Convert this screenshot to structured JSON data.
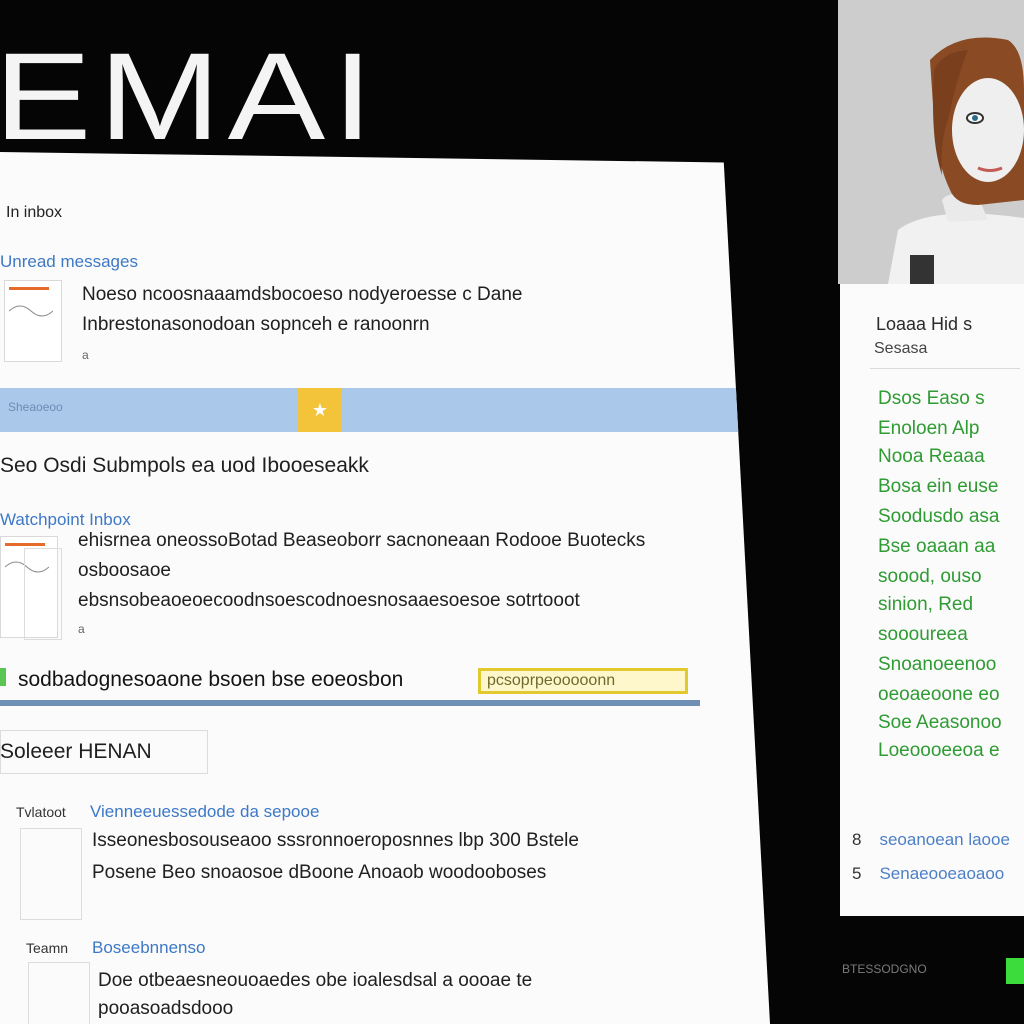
{
  "banner": {
    "text": "EMAI"
  },
  "doc": {
    "header": "In inbox",
    "messages": [
      {
        "title": "Unread messages",
        "lines": [
          "Noeso ncoosnaaamdsbocoeso nodyeroesse c Dane",
          "Inbrestonasonodoan sopnceh e ranoonrn"
        ],
        "dot": "a"
      },
      {
        "title": "Watchpoint Inbox",
        "lines": [
          "ehisrnea oneossoBotad Beaseoborr sacnoneaan Rodooe Buotecks",
          "osboosaoe",
          "ebsnsobeaoeoecoodnsoescodnoesnosaaesoesoe sotrtooot"
        ],
        "dot": "a"
      },
      {
        "title": "Vienneeuessedode da sepooe",
        "lines": [
          "Isseonesbosouseaoo sssronnoeroposnnes lbp 300 Bstele",
          "Posene Beo snoaosoe dBoone Anoaob woodooboses"
        ],
        "dot": ""
      },
      {
        "title": "Boseebnnenso",
        "lines": [
          "Doe otbeaesneouoaedes obe ioalesdsal a oooae te",
          "pooasoadsdooo"
        ],
        "dot": ""
      }
    ],
    "separator": {
      "label": "Sheaoeoo",
      "badge_icon": "star-icon"
    },
    "section1": "Seo Osdi Submpols ea uod Ibooeseakk",
    "highlight": {
      "text": "sodbadognesoaone bsoen bse eoeosbon",
      "tag": "pcsoprpeooooonn"
    },
    "section2": "Soleeer HENAN",
    "row_labels": [
      "Tvlatoot",
      "Teamn"
    ]
  },
  "sidebar": {
    "title": "Loaaa Hid s",
    "sub": "Sesasa",
    "green_lines": [
      "Dsos Easo s",
      "Enoloen Alp",
      "Nooa Reaaa",
      "Bosa ein euse",
      "Soodusdo asa",
      "Bse oaaan aa",
      "soood, ouso",
      "sinion, Red",
      "soooureea",
      "Snoanoeenoo",
      "oeoaeoone eo",
      "Soe Aeasonoo",
      "Loeoooeeoa e"
    ],
    "bottom": [
      {
        "num": "8",
        "text": "seoanoean laooe"
      },
      {
        "num": "5",
        "text": "Senaeooeaoaoo"
      }
    ]
  },
  "status": {
    "text": "BTESSODGNO"
  },
  "colors": {
    "accent_blue": "#3d78c6",
    "green_text": "#2f9b33",
    "highlight_yellow": "#e2c92f",
    "separator_blue": "#a9c8ea"
  }
}
